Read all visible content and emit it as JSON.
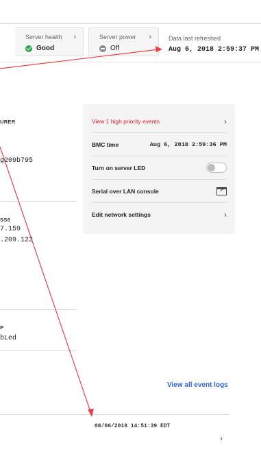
{
  "status": {
    "health": {
      "label": "Server health",
      "value": "Good",
      "icon": "check-circle-icon"
    },
    "power": {
      "label": "Server power",
      "value": "Off",
      "icon": "minus-circle-icon"
    },
    "refresh": {
      "label": "Data last refreshed",
      "value": "Aug 6, 2018 2:59:37 PM"
    }
  },
  "info": {
    "manufacturer_header": "URER",
    "serial_fragment": "g209b795",
    "network_header": "SS6",
    "ip_one": "7.159",
    "ip_two": ".209.123",
    "led_header": "P",
    "led_value": "bLed"
  },
  "quick": {
    "events_label": "View 1 high priority events",
    "bmc_label": "BMC time",
    "bmc_value": "Aug 6, 2018 2:59:36 PM",
    "led_label": "Turn on server LED",
    "sol_label": "Serial over LAN console",
    "network_label": "Edit network settings"
  },
  "events": {
    "view_all_label": "View all event logs",
    "last_date": "08/06/2018 14:51:39 EDT"
  },
  "colors": {
    "annotation": "#e8404a",
    "link": "#2d63d6",
    "alert": "#d81f26",
    "ok": "#2fa84f"
  }
}
